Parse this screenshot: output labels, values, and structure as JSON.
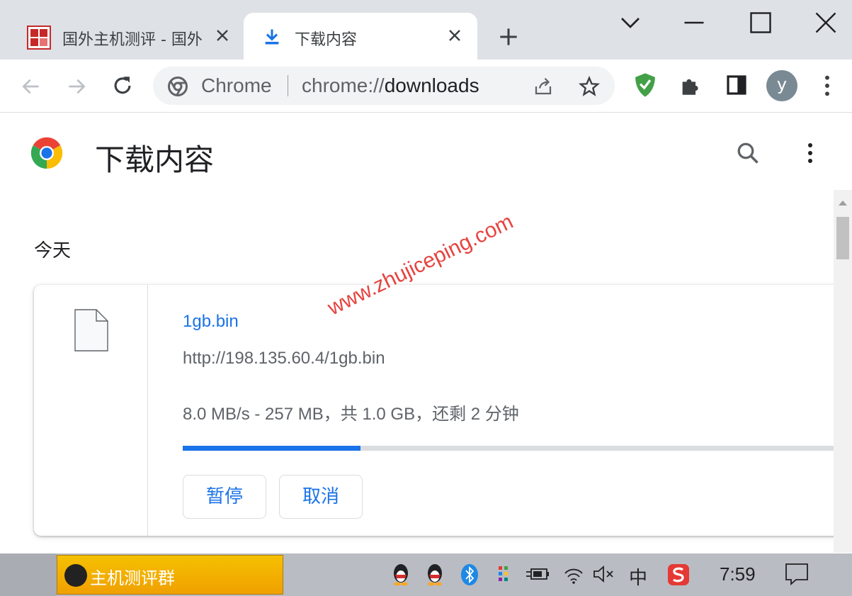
{
  "browser": {
    "tabs": [
      {
        "title": "国外主机测评 - 国外",
        "icon": "site-favicon-icon",
        "active": false
      },
      {
        "title": "下载内容",
        "icon": "download-icon",
        "active": true
      }
    ],
    "new_tab_icon": "plus-icon",
    "window_controls": [
      "chevron-down-icon",
      "minimize-icon",
      "maximize-icon",
      "close-icon"
    ]
  },
  "toolbar": {
    "omnibox_label": "Chrome",
    "url_scheme": "chrome://",
    "url_host": "downloads",
    "avatar_initial": "y"
  },
  "page": {
    "title": "下载内容",
    "section": "今天"
  },
  "download": {
    "file_name": "1gb.bin",
    "url": "http://198.135.60.4/1gb.bin",
    "status": "8.0 MB/s - 257 MB，共 1.0 GB，还剩 2 分钟",
    "progress": 0.27,
    "pause_label": "暂停",
    "cancel_label": "取消"
  },
  "watermark": "www.zhujiceping.com",
  "taskbar": {
    "app_label": "主机测评群",
    "ime": "中",
    "clock": "7:59"
  },
  "colors": {
    "accent": "#1a73e8",
    "tab_strip": "#dee1e6",
    "taskbar_app": "#f5b800",
    "watermark": "#e53935"
  }
}
